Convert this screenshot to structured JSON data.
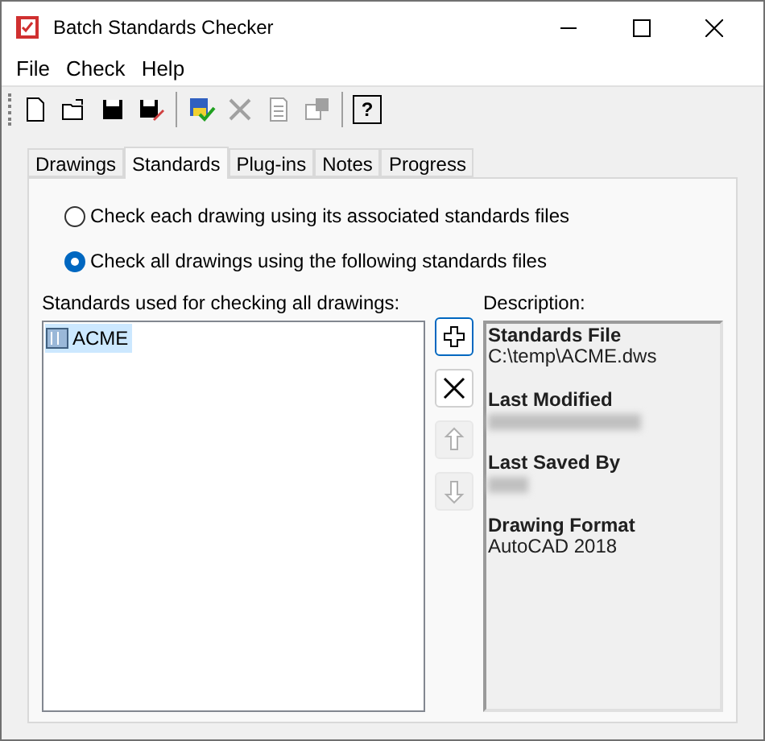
{
  "window": {
    "title": "Batch Standards Checker"
  },
  "menu": [
    "File",
    "Check",
    "Help"
  ],
  "toolbar": [
    {
      "kind": "new",
      "disabled": false
    },
    {
      "kind": "open",
      "disabled": false
    },
    {
      "kind": "save",
      "disabled": false
    },
    {
      "kind": "saveas",
      "disabled": false
    },
    {
      "kind": "sep"
    },
    {
      "kind": "check",
      "disabled": false
    },
    {
      "kind": "delete",
      "disabled": true
    },
    {
      "kind": "copy",
      "disabled": true
    },
    {
      "kind": "props",
      "disabled": true
    },
    {
      "kind": "sep"
    },
    {
      "kind": "help",
      "label": "?",
      "disabled": false
    }
  ],
  "tabs": [
    {
      "label": "Drawings",
      "selected": false
    },
    {
      "label": "Standards",
      "selected": true
    },
    {
      "label": "Plug-ins",
      "selected": false
    },
    {
      "label": "Notes",
      "selected": false
    },
    {
      "label": "Progress",
      "selected": false
    }
  ],
  "options": [
    {
      "label": "Check each drawing using its associated standards files",
      "selected": false
    },
    {
      "label": "Check all drawings using the following standards files",
      "selected": true
    }
  ],
  "list": {
    "label": "Standards used for checking all drawings:",
    "items": [
      {
        "name": "ACME",
        "selected": true
      }
    ]
  },
  "buttons": [
    {
      "kind": "add",
      "disabled": false
    },
    {
      "kind": "remove",
      "disabled": false
    },
    {
      "kind": "up",
      "disabled": true
    },
    {
      "kind": "down",
      "disabled": true
    }
  ],
  "description": {
    "label": "Description:",
    "sections": [
      {
        "heading": "Standards File",
        "kind": "text",
        "value": "C:\\temp\\ACME.dws"
      },
      {
        "heading": "Last Modified",
        "kind": "blurred"
      },
      {
        "heading": "Last Saved By",
        "kind": "blurred"
      },
      {
        "heading": "Drawing Format",
        "kind": "text",
        "value": "AutoCAD 2018"
      }
    ]
  }
}
